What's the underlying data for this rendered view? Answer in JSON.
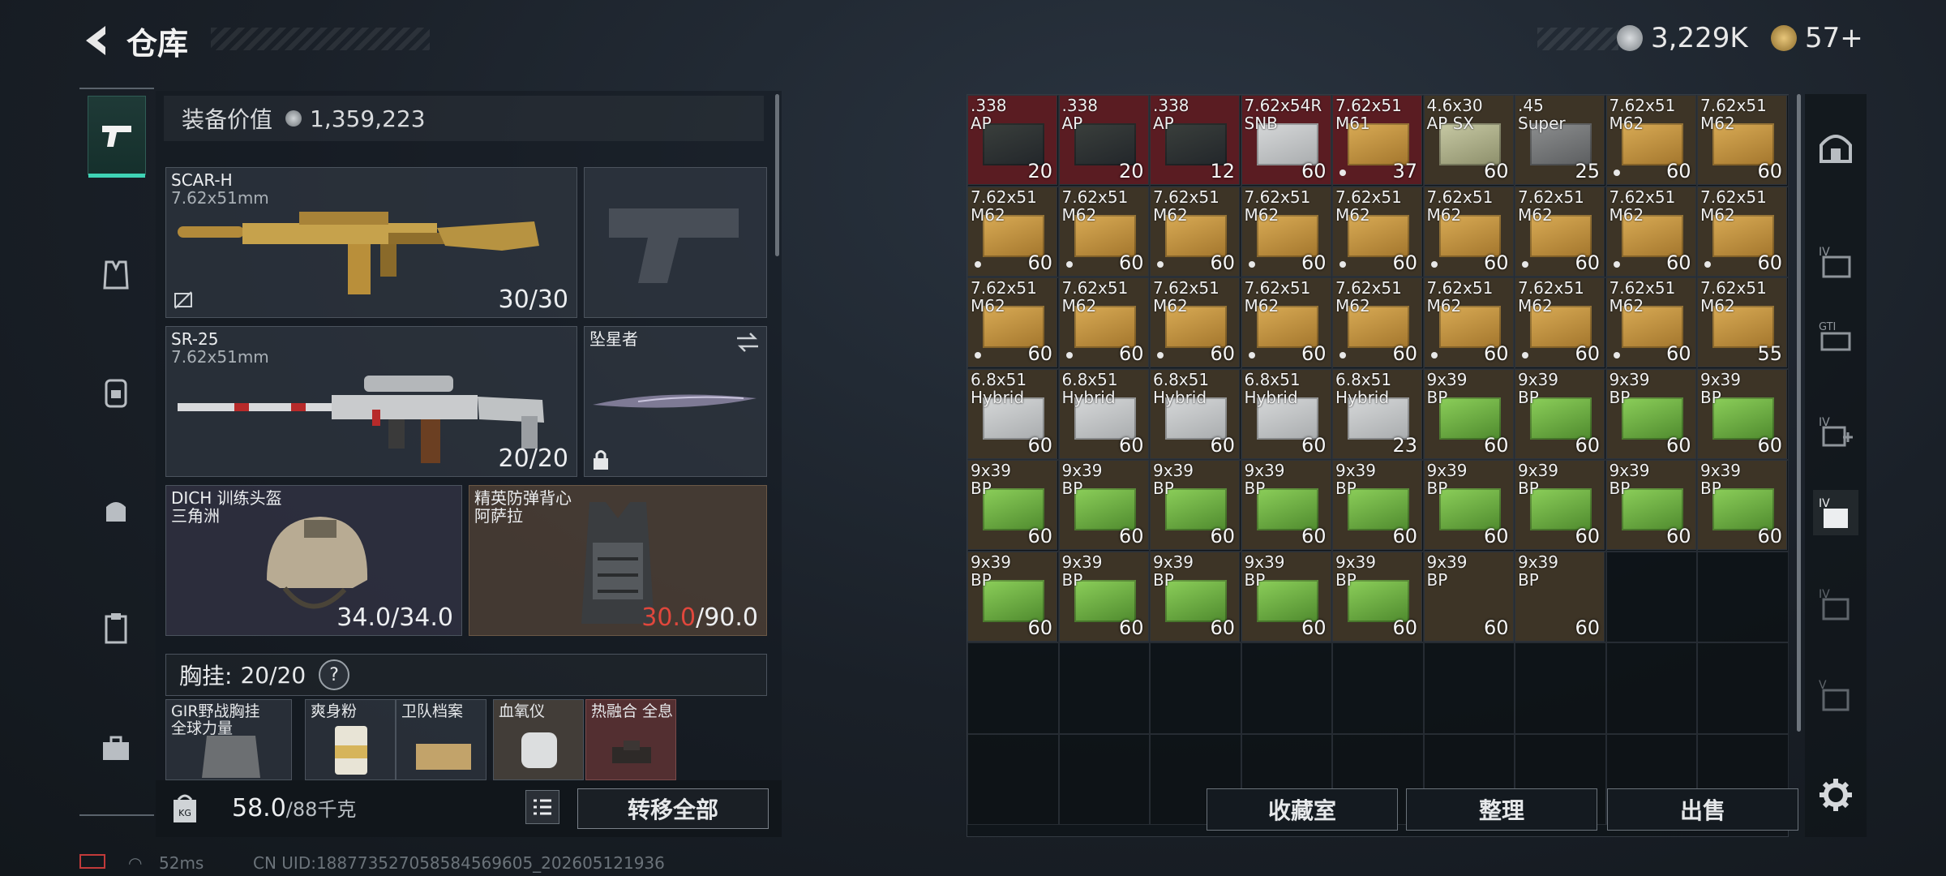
{
  "header": {
    "title": "仓库",
    "currency1": "3,229K",
    "currency2": "57+"
  },
  "equipment": {
    "value_label": "装备价值",
    "value": "1,359,223",
    "primary": {
      "name": "SCAR-H",
      "caliber": "7.62x51mm",
      "ammo": "30/30"
    },
    "secondary": {
      "name": "SR-25",
      "caliber": "7.62x51mm",
      "ammo": "20/20"
    },
    "melee": {
      "name": "坠星者"
    },
    "helmet": {
      "name": "DICH 训练头盔",
      "sub": "三角洲",
      "durability": "34.0/34.0"
    },
    "armor": {
      "name": "精英防弹背心",
      "sub": "阿萨拉",
      "durability_cur": "30.0",
      "durability_max": "/90.0"
    },
    "chest_rig": {
      "label": "胸挂:",
      "value": "20/20",
      "help": "?"
    },
    "pouch_items": [
      {
        "name": "GIR野战胸挂\n全球力量"
      },
      {
        "name": "爽身粉"
      },
      {
        "name": "卫队档案"
      },
      {
        "name": "血氧仪"
      },
      {
        "name": "热融合 全息"
      }
    ],
    "weight": "58.0",
    "weight_max": "/88千克",
    "transfer_all": "转移全部"
  },
  "status": {
    "ping": "52ms",
    "uid": "CN UID:188773527058584569605_202605121936"
  },
  "colors": {
    "red_bg": "#5a1c22",
    "tan_bg": "#3d3426",
    "green_bg": "#34301f",
    "accent": "#3fd3b5",
    "warn": "#e0473c"
  },
  "grid_items": [
    {
      "t": ".338\nAP",
      "q": "20",
      "k": "red",
      "b": "dark"
    },
    {
      "t": ".338\nAP",
      "q": "20",
      "k": "red",
      "b": "dark"
    },
    {
      "t": ".338\nAP",
      "q": "12",
      "k": "red",
      "b": "dark"
    },
    {
      "t": "7.62x54R\nSNB",
      "q": "60",
      "k": "red",
      "b": "white"
    },
    {
      "t": "7.62x51\nM61",
      "q": "37",
      "k": "red",
      "b": "tan",
      "d": true
    },
    {
      "t": "4.6x30\nAP SX",
      "q": "60",
      "k": "tan",
      "b": "lgreen"
    },
    {
      "t": ".45\nSuper",
      "q": "25",
      "k": "tan",
      "b": "gray"
    },
    {
      "t": "7.62x51\nM62",
      "q": "60",
      "k": "tan",
      "b": "tan",
      "d": true
    },
    {
      "t": "7.62x51\nM62",
      "q": "60",
      "k": "tan",
      "b": "tan"
    },
    {
      "t": "7.62x51\nM62",
      "q": "60",
      "k": "tan",
      "b": "tan",
      "d": true
    },
    {
      "t": "7.62x51\nM62",
      "q": "60",
      "k": "tan",
      "b": "tan",
      "d": true
    },
    {
      "t": "7.62x51\nM62",
      "q": "60",
      "k": "tan",
      "b": "tan",
      "d": true
    },
    {
      "t": "7.62x51\nM62",
      "q": "60",
      "k": "tan",
      "b": "tan",
      "d": true
    },
    {
      "t": "7.62x51\nM62",
      "q": "60",
      "k": "tan",
      "b": "tan",
      "d": true
    },
    {
      "t": "7.62x51\nM62",
      "q": "60",
      "k": "tan",
      "b": "tan",
      "d": true
    },
    {
      "t": "7.62x51\nM62",
      "q": "60",
      "k": "tan",
      "b": "tan",
      "d": true
    },
    {
      "t": "7.62x51\nM62",
      "q": "60",
      "k": "tan",
      "b": "tan",
      "d": true
    },
    {
      "t": "7.62x51\nM62",
      "q": "60",
      "k": "tan",
      "b": "tan",
      "d": true
    },
    {
      "t": "7.62x51\nM62",
      "q": "60",
      "k": "tan",
      "b": "tan",
      "d": true
    },
    {
      "t": "7.62x51\nM62",
      "q": "60",
      "k": "tan",
      "b": "tan",
      "d": true
    },
    {
      "t": "7.62x51\nM62",
      "q": "60",
      "k": "tan",
      "b": "tan",
      "d": true
    },
    {
      "t": "7.62x51\nM62",
      "q": "60",
      "k": "tan",
      "b": "tan",
      "d": true
    },
    {
      "t": "7.62x51\nM62",
      "q": "60",
      "k": "tan",
      "b": "tan",
      "d": true
    },
    {
      "t": "7.62x51\nM62",
      "q": "60",
      "k": "tan",
      "b": "tan",
      "d": true
    },
    {
      "t": "7.62x51\nM62",
      "q": "60",
      "k": "tan",
      "b": "tan",
      "d": true
    },
    {
      "t": "7.62x51\nM62",
      "q": "60",
      "k": "tan",
      "b": "tan",
      "d": true
    },
    {
      "t": "7.62x51\nM62",
      "q": "55",
      "k": "tan",
      "b": "tan"
    },
    {
      "t": "6.8x51\nHybrid",
      "q": "60",
      "k": "tan",
      "b": "white"
    },
    {
      "t": "6.8x51\nHybrid",
      "q": "60",
      "k": "tan",
      "b": "white"
    },
    {
      "t": "6.8x51\nHybrid",
      "q": "60",
      "k": "tan",
      "b": "white"
    },
    {
      "t": "6.8x51\nHybrid",
      "q": "60",
      "k": "tan",
      "b": "white"
    },
    {
      "t": "6.8x51\nHybrid",
      "q": "23",
      "k": "tan",
      "b": "white"
    },
    {
      "t": "9x39\nBP",
      "q": "60",
      "k": "tan",
      "b": "green"
    },
    {
      "t": "9x39\nBP",
      "q": "60",
      "k": "tan",
      "b": "green"
    },
    {
      "t": "9x39\nBP",
      "q": "60",
      "k": "tan",
      "b": "green"
    },
    {
      "t": "9x39\nBP",
      "q": "60",
      "k": "tan",
      "b": "green"
    },
    {
      "t": "9x39\nBP",
      "q": "60",
      "k": "tan",
      "b": "green"
    },
    {
      "t": "9x39\nBP",
      "q": "60",
      "k": "tan",
      "b": "green"
    },
    {
      "t": "9x39\nBP",
      "q": "60",
      "k": "tan",
      "b": "green"
    },
    {
      "t": "9x39\nBP",
      "q": "60",
      "k": "tan",
      "b": "green"
    },
    {
      "t": "9x39\nBP",
      "q": "60",
      "k": "tan",
      "b": "green"
    },
    {
      "t": "9x39\nBP",
      "q": "60",
      "k": "tan",
      "b": "green"
    },
    {
      "t": "9x39\nBP",
      "q": "60",
      "k": "tan",
      "b": "green"
    },
    {
      "t": "9x39\nBP",
      "q": "60",
      "k": "tan",
      "b": "green"
    },
    {
      "t": "9x39\nBP",
      "q": "60",
      "k": "tan",
      "b": "green"
    },
    {
      "t": "9x39\nBP",
      "q": "60",
      "k": "tan",
      "b": "green"
    },
    {
      "t": "9x39\nBP",
      "q": "60",
      "k": "tan",
      "b": "green"
    },
    {
      "t": "9x39\nBP",
      "q": "60",
      "k": "tan",
      "b": "green"
    },
    {
      "t": "9x39\nBP",
      "q": "60",
      "k": "tan",
      "b": "green"
    },
    {
      "t": "9x39\nBP",
      "q": "60",
      "k": "tan",
      "b": "green"
    },
    {
      "t": "9x39\nBP",
      "q": "60",
      "k": "tan",
      "b": "none"
    },
    {
      "t": "9x39\nBP",
      "q": "60",
      "k": "tan",
      "b": "none"
    }
  ],
  "actions": {
    "collection": "收藏室",
    "sort": "整理",
    "sell": "出售"
  }
}
